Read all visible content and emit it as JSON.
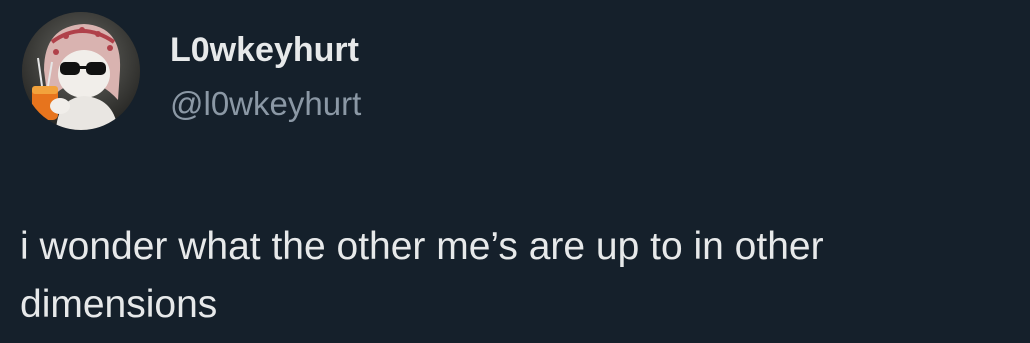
{
  "tweet": {
    "display_name": "L0wkeyhurt",
    "handle": "@l0wkeyhurt",
    "text": "i wonder what the other me’s are up to in other dimensions",
    "avatar_icon": "avatar-cat-with-sunglasses-and-headscarf"
  },
  "colors": {
    "background": "#15202b",
    "primary_text": "#e7e9ea",
    "secondary_text": "#8b98a5"
  }
}
